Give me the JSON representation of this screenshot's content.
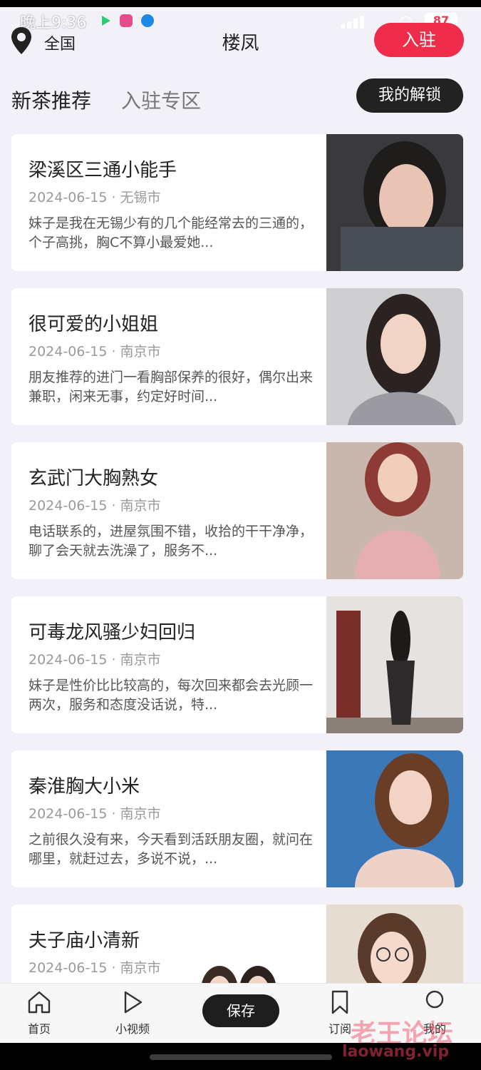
{
  "status_bar": {
    "time": "晚上9:36",
    "battery": "87"
  },
  "header": {
    "location_label": "全国",
    "title": "楼凤",
    "join_button": "入驻"
  },
  "tabs": {
    "new_recommend": "新茶推荐",
    "join_zone": "入驻专区",
    "my_unlock": "我的解锁"
  },
  "cards": [
    {
      "title": "梁溪区三通小能手",
      "meta": "2024-06-15 · 无锡市",
      "desc": "妹子是我在无锡少有的几个能经常去的三通的，个子高挑，胸C不算小最爱她..."
    },
    {
      "title": "很可爱的小姐姐",
      "meta": "2024-06-15 · 南京市",
      "desc": "朋友推荐的进门一看胸部保养的很好，偶尔出来兼职，闲来无事，约定好时间..."
    },
    {
      "title": "玄武门大胸熟女",
      "meta": "2024-06-15 · 南京市",
      "desc": "电话联系的，进屋氛围不错，收拾的干干净净，聊了会天就去洗澡了，服务不..."
    },
    {
      "title": "可毒龙风骚少妇回归",
      "meta": "2024-06-15 · 南京市",
      "desc": "妹子是性价比比较高的，每次回来都会去光顾一两次，服务和态度没话说，特..."
    },
    {
      "title": "秦淮胸大小米",
      "meta": "2024-06-15 · 南京市",
      "desc": "之前很久没有来，今天看到活跃朋友圈，就问在哪里，就赶过去，多说不说，..."
    },
    {
      "title": "夫子庙小清新",
      "meta": "2024-06-15 · 南京市",
      "desc": ""
    }
  ],
  "bottom_nav": {
    "home": "首页",
    "videos": "小视频",
    "save": "保存",
    "subscribe": "订阅",
    "mine": "我的"
  },
  "watermark": {
    "text": "老王论坛",
    "url": "laowang.vip"
  },
  "colors": {
    "accent": "#f02c4b",
    "background": "#f1f1f7",
    "dark_button": "#222222"
  }
}
